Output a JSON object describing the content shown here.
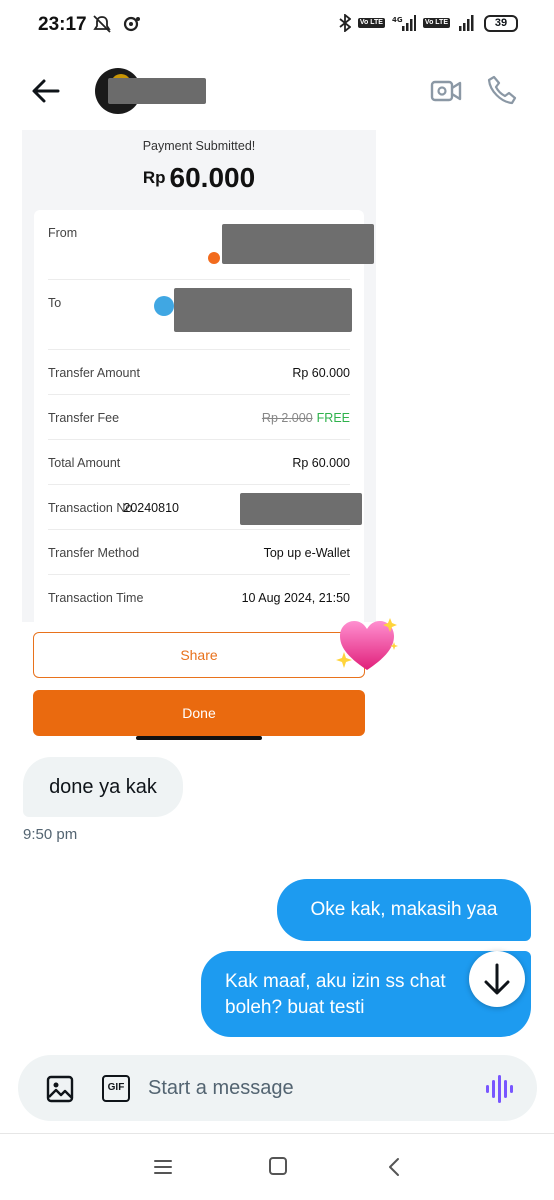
{
  "status_bar": {
    "time": "23:17",
    "network_tags": [
      "Vo LTE",
      "4G",
      "Vo LTE"
    ],
    "battery": "39"
  },
  "header": {
    "contact_name": "",
    "icons": [
      "arrow-left-icon",
      "video-icon",
      "phone-icon"
    ]
  },
  "receipt": {
    "status": "Payment Submitted!",
    "currency": "Rp",
    "amount": "60.000",
    "from_label": "From",
    "to_label": "To",
    "rows": [
      {
        "label": "Transfer Amount",
        "value": "Rp 60.000"
      },
      {
        "label": "Transfer Fee",
        "old_value": "Rp 2.000",
        "value": "FREE"
      },
      {
        "label": "Total Amount",
        "value": "Rp 60.000"
      },
      {
        "label": "Transaction No.",
        "value": "20240810"
      },
      {
        "label": "Transfer Method",
        "value": "Top up e-Wallet"
      },
      {
        "label": "Transaction Time",
        "value": "10 Aug 2024, 21:50"
      }
    ],
    "share_label": "Share",
    "done_label": "Done"
  },
  "chat": {
    "messages": [
      {
        "direction": "in",
        "text": "done ya kak",
        "time": "9:50 pm"
      },
      {
        "direction": "out",
        "text": "Oke kak, makasih yaa"
      },
      {
        "direction": "out",
        "text": "Kak maaf, aku izin ss chat boleh? buat testi"
      }
    ]
  },
  "composer": {
    "placeholder": "Start a message",
    "gif_label": "GIF"
  },
  "colors": {
    "accent_blue": "#1d9bf0",
    "orange": "#ea6a0f",
    "free_green": "#2fb24c"
  }
}
